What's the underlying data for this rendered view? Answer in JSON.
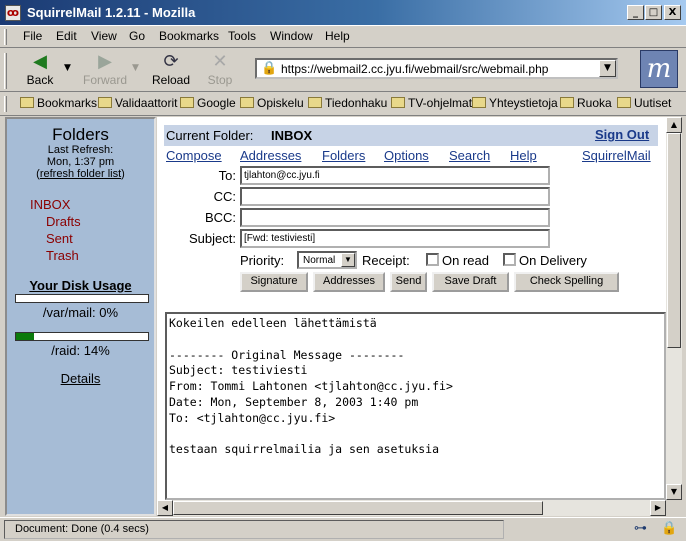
{
  "window": {
    "title": "SquirrelMail 1.2.11 - Mozilla",
    "minimize": "_",
    "maximize": "□",
    "close": "X"
  },
  "menu": [
    "File",
    "Edit",
    "View",
    "Go",
    "Bookmarks",
    "Tools",
    "Window",
    "Help"
  ],
  "nav": {
    "back": "Back",
    "forward": "Forward",
    "reload": "Reload",
    "stop": "Stop",
    "url": "https://webmail2.cc.jyu.fi/webmail/src/webmail.php"
  },
  "bookmarks": [
    "Bookmarks",
    "Validaattorit",
    "Google",
    "Opiskelu",
    "Tiedonhaku",
    "TV-ohjelmat",
    "Yhteystietoja",
    "Ruoka",
    "Uutiset"
  ],
  "sidebar": {
    "title": "Folders",
    "last_refresh": "Last Refresh:",
    "refresh_time": "Mon, 1:37 pm",
    "refresh_paren_open": "(",
    "refresh_link": "refresh folder list",
    "refresh_paren_close": ")",
    "folders": [
      "INBOX",
      "Drafts",
      "Sent",
      "Trash"
    ],
    "disk_title": "Your Disk Usage",
    "quotas": [
      {
        "label": "/var/mail: 0%",
        "fraction": 0.0
      },
      {
        "label": "/raid: 14%",
        "fraction": 0.14
      }
    ],
    "details": "Details"
  },
  "header": {
    "current_folder_label": "Current Folder:",
    "current_folder": "INBOX",
    "sign_out": "Sign Out"
  },
  "nav_links": [
    "Compose",
    "Addresses",
    "Folders",
    "Options",
    "Search",
    "Help"
  ],
  "brand_link": "SquirrelMail",
  "compose": {
    "to_label": "To:",
    "to_value": "tjlahton@cc.jyu.fi",
    "cc_label": "CC:",
    "cc_value": "",
    "bcc_label": "BCC:",
    "bcc_value": "",
    "subject_label": "Subject:",
    "subject_value": "[Fwd: testiviesti]",
    "priority_label": "Priority:",
    "priority_value": "Normal",
    "receipt_label": "Receipt:",
    "on_read": "On read",
    "on_delivery": "On Delivery",
    "buttons": [
      "Signature",
      "Addresses",
      "Send",
      "Save Draft",
      "Check Spelling"
    ],
    "body": "Kokeilen edelleen lähettämistä\n\n-------- Original Message --------\nSubject: testiviesti\nFrom: Tommi Lahtonen <tjlahton@cc.jyu.fi>\nDate: Mon, September 8, 2003 1:40 pm\nTo: <tjlahton@cc.jyu.fi>\n\ntestaan squirrelmailia ja sen asetuksia"
  },
  "status": {
    "text": "Document: Done (0.4 secs)"
  },
  "colors": {
    "sidebar_bg": "#a6bcd6",
    "header_band": "#c7d3e6",
    "link": "#1a3a8a",
    "folder_red": "#8b0000",
    "quota_fill": "#0b7a0b"
  }
}
